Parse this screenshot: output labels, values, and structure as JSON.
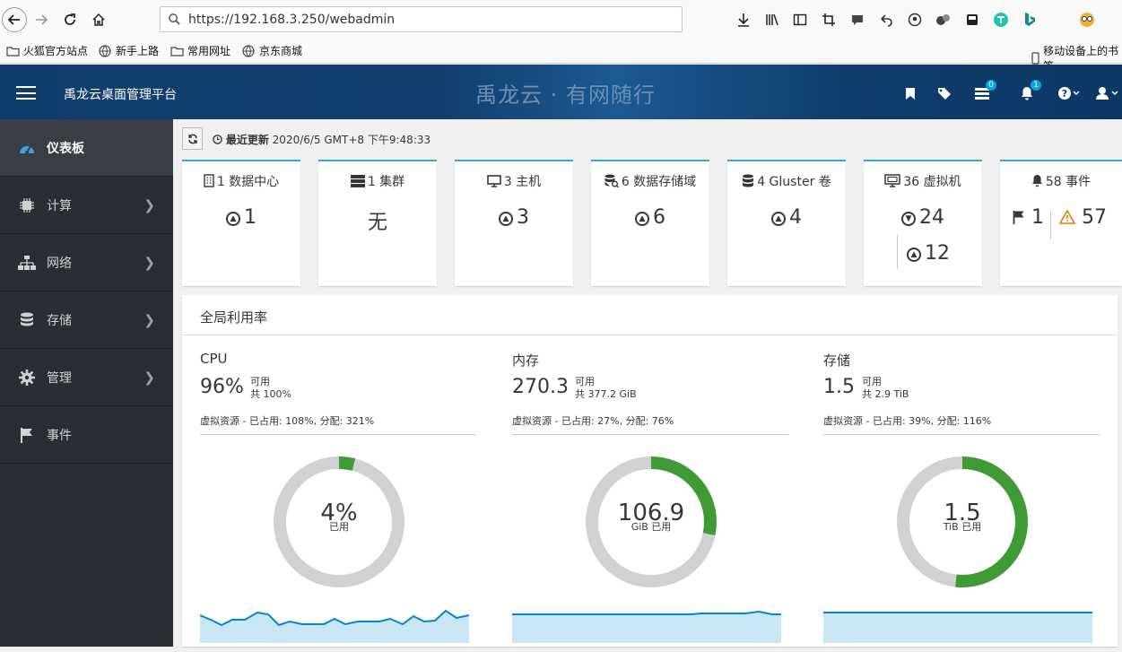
{
  "browser": {
    "url": "https://192.168.3.250/webadmin",
    "bookmarks": [
      "火狐官方站点",
      "新手上路",
      "常用网址",
      "京东商城"
    ],
    "mobile_bookmarks": "移动设备上的书签"
  },
  "header": {
    "brand": "禹龙云桌面管理平台",
    "banner": "禹龙云 · 有网随行",
    "tasks_badge": "0",
    "alerts_badge": "1"
  },
  "sidebar": {
    "items": [
      {
        "label": "仪表板",
        "icon": "dashboard-icon"
      },
      {
        "label": "计算",
        "icon": "cpu-icon"
      },
      {
        "label": "网络",
        "icon": "network-icon"
      },
      {
        "label": "存储",
        "icon": "database-icon"
      },
      {
        "label": "管理",
        "icon": "gear-icon"
      },
      {
        "label": "事件",
        "icon": "flag-icon"
      }
    ]
  },
  "toolbar": {
    "last_update_label": "最近更新",
    "last_update_value": "2020/6/5 GMT+8 下午9:48:33"
  },
  "cards": {
    "datacenter": {
      "title": "1 数据中心",
      "value": "1"
    },
    "cluster": {
      "title": "1 集群",
      "value": "无"
    },
    "host": {
      "title": "3 主机",
      "value": "3"
    },
    "storage_domain": {
      "title": "6 数据存储域",
      "value": "6"
    },
    "gluster": {
      "title": "4 Gluster 卷",
      "value": "4"
    },
    "vm": {
      "title": "36 虚拟机",
      "down": "24",
      "up": "12"
    },
    "events": {
      "title": "58 事件",
      "flag": "1",
      "warning": "57"
    }
  },
  "utilization": {
    "title": "全局利用率",
    "cpu": {
      "name": "CPU",
      "big": "96%",
      "avail": "可用",
      "total": "共 100%",
      "virtual": "虚拟资源 - 已占用: 108%, 分配: 321%",
      "donut_value": "4%",
      "donut_unit": "已用",
      "used_fraction": 0.04
    },
    "memory": {
      "name": "内存",
      "big": "270.3",
      "avail": "可用",
      "total": "共 377.2 GiB",
      "virtual": "虚拟资源 - 已占用: 27%, 分配: 76%",
      "donut_value": "106.9",
      "donut_unit": "GiB 已用",
      "used_fraction": 0.283
    },
    "storage": {
      "name": "存储",
      "big": "1.5",
      "avail": "可用",
      "total": "共 2.9 TiB",
      "virtual": "虚拟资源 - 已占用: 39%, 分配: 116%",
      "donut_value": "1.5",
      "donut_unit": "TiB 已用",
      "used_fraction": 0.517
    }
  },
  "colors": {
    "accent": "#39a5dc",
    "donut_used": "#3f9c35",
    "donut_free": "#d1d1d1",
    "spark_line": "#0088ce",
    "spark_fill": "#c9e6f5"
  }
}
